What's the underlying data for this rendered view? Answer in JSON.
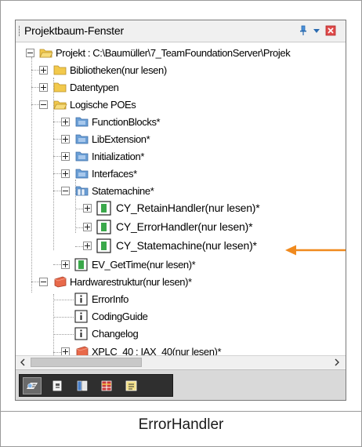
{
  "window": {
    "title": "Projektbaum-Fenster",
    "caption": "ErrorHandler"
  },
  "tree": {
    "root": "Projekt : C:\\Baumüller\\7_TeamFoundationServer\\Projek",
    "items": [
      {
        "label": "Bibliotheken(nur lesen)"
      },
      {
        "label": "Datentypen"
      },
      {
        "label": "Logische POEs"
      },
      {
        "label": "FunctionBlocks*"
      },
      {
        "label": "LibExtension*"
      },
      {
        "label": "Initialization*"
      },
      {
        "label": "Interfaces*"
      },
      {
        "label": "Statemachine*"
      },
      {
        "label": "CY_RetainHandler(nur lesen)*"
      },
      {
        "label": "CY_ErrorHandler(nur lesen)*"
      },
      {
        "label": "CY_Statemachine(nur lesen)*"
      },
      {
        "label": "EV_GetTime(nur lesen)*"
      },
      {
        "label": "Hardwarestruktur(nur lesen)*"
      },
      {
        "label": "ErrorInfo"
      },
      {
        "label": "CodingGuide"
      },
      {
        "label": "Changelog"
      },
      {
        "label": "XPLC_40 : IAX_40(nur lesen)*"
      }
    ]
  },
  "colors": {
    "arrow": "#f08a1e",
    "folder_yellow": "#f2c94c",
    "folder_blue": "#6b9fd6",
    "hw_red": "#e8694a",
    "poe_green": "#3aa84a"
  },
  "icons": {
    "pin": "pin-icon",
    "menu": "dropdown-menu-icon",
    "close": "close-icon"
  }
}
